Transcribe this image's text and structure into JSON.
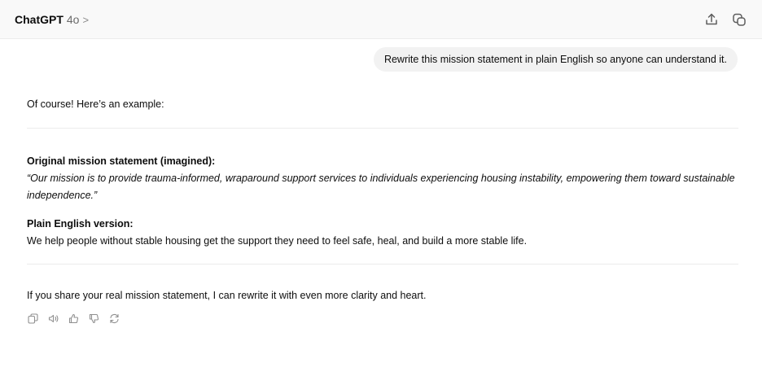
{
  "header": {
    "app_name": "ChatGPT",
    "model_name": "4o",
    "chevron": ">"
  },
  "conversation": {
    "user_message": "Rewrite this mission statement in plain English so anyone can understand it.",
    "assistant": {
      "intro": "Of course! Here’s an example:",
      "original_heading": "Original mission statement (imagined):",
      "original_text": "“Our mission is to provide trauma-informed, wraparound support services to individuals experiencing housing instability, empowering them toward sustainable independence.”",
      "plain_heading": "Plain English version:",
      "plain_text": "We help people without stable housing get the support they need to feel safe, heal, and build a more stable life.",
      "closing": "If you share your real mission statement, I can rewrite it with even more clarity and heart."
    }
  },
  "icons": {
    "share": "share-icon",
    "new_chat": "new-chat-icon",
    "copy": "copy-icon",
    "read_aloud": "speaker-icon",
    "thumbs_up": "thumbs-up-icon",
    "thumbs_down": "thumbs-down-icon",
    "regenerate": "regenerate-icon"
  }
}
